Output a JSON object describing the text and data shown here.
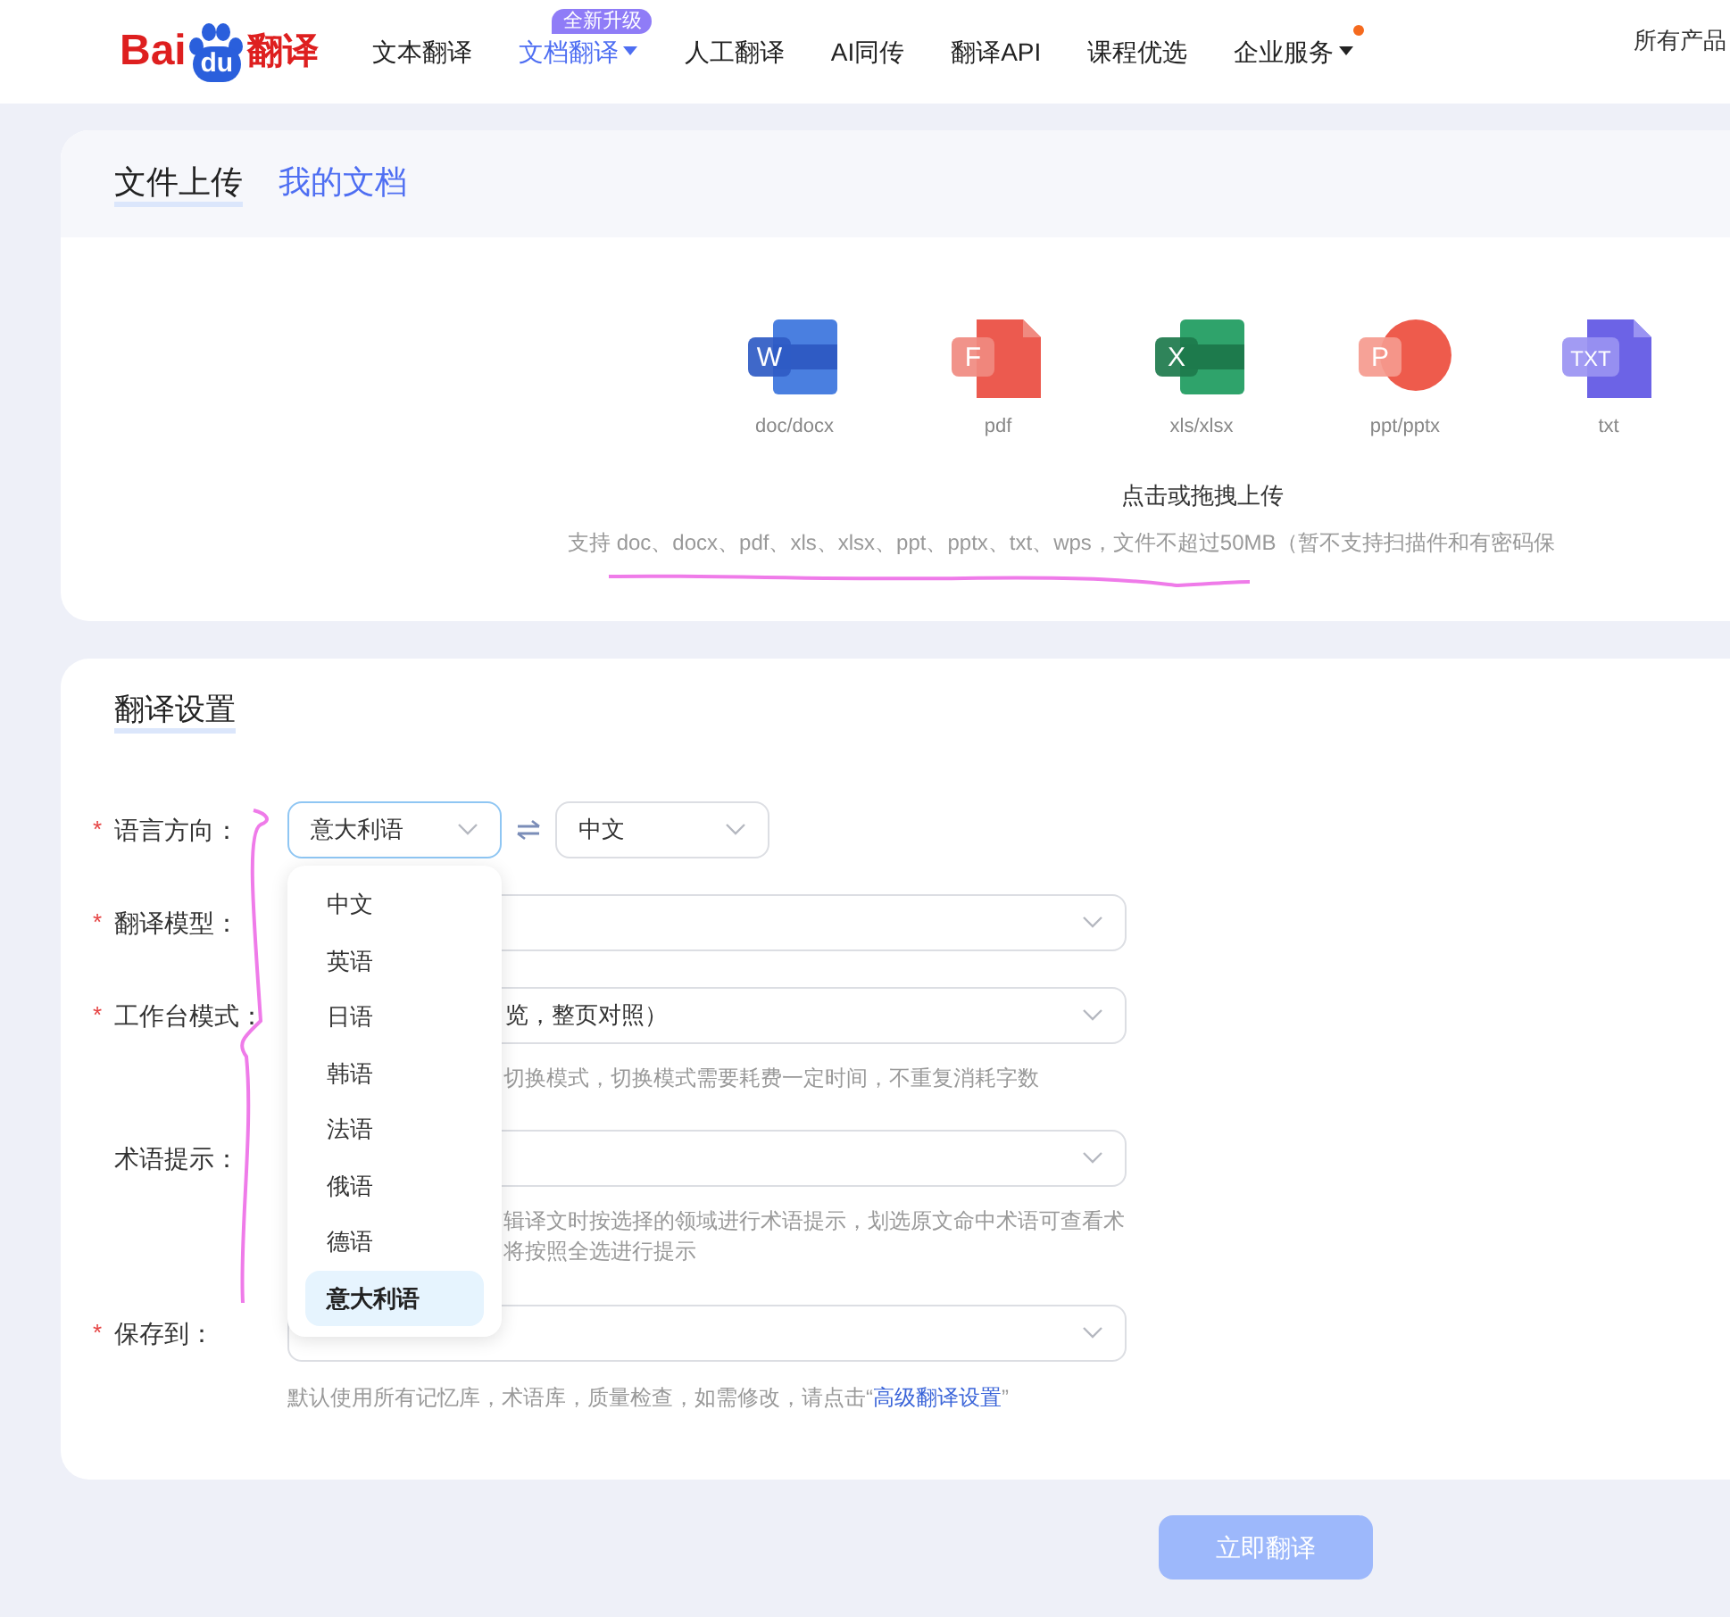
{
  "header": {
    "logo": {
      "left": "Bai",
      "paw": "du",
      "right": "翻译"
    },
    "nav": [
      {
        "label": "文本翻译",
        "selected": false,
        "caret": false,
        "dot": false
      },
      {
        "label": "文档翻译",
        "selected": true,
        "caret": true,
        "dot": false,
        "badge": "全新升级"
      },
      {
        "label": "人工翻译",
        "selected": false,
        "caret": false,
        "dot": false
      },
      {
        "label": "AI同传",
        "selected": false,
        "caret": false,
        "dot": false
      },
      {
        "label": "翻译API",
        "selected": false,
        "caret": false,
        "dot": false
      },
      {
        "label": "课程优选",
        "selected": false,
        "caret": false,
        "dot": false
      },
      {
        "label": "企业服务",
        "selected": false,
        "caret": true,
        "dot": true
      }
    ],
    "all_products": "所有产品"
  },
  "upload": {
    "tabs": [
      {
        "label": "文件上传",
        "selected": true
      },
      {
        "label": "我的文档",
        "selected": false
      }
    ],
    "file_types": [
      {
        "kind": "word",
        "letter": "W",
        "label": "doc/docx"
      },
      {
        "kind": "pdf",
        "letter": "F",
        "label": "pdf"
      },
      {
        "kind": "excel",
        "letter": "X",
        "label": "xls/xlsx"
      },
      {
        "kind": "ppt",
        "letter": "P",
        "label": "ppt/pptx"
      },
      {
        "kind": "txt",
        "letter": "TXT",
        "label": "txt"
      }
    ],
    "prompt": "点击或拖拽上传",
    "note": "支持 doc、docx、pdf、xls、xlsx、ppt、pptx、txt、wps，文件不超过50MB（暂不支持扫描件和有密码保"
  },
  "settings": {
    "title": "翻译设置",
    "rows": [
      {
        "kind": "language_pair",
        "label": "语言方向：",
        "required": "*",
        "source": "意大利语",
        "target": "中文"
      },
      {
        "kind": "select",
        "label": "翻译模型：",
        "required": "*"
      },
      {
        "kind": "select",
        "label": "工作台模式：",
        "required": "*",
        "value": "览，整页对照）",
        "hint": [
          "切换模式，切换模式需要耗费一定时间，不重复消耗字数"
        ]
      },
      {
        "kind": "select",
        "label": "术语提示：",
        "hint": [
          "辑译文时按选择的领域进行术语提示，划选原文命中术语可查看术",
          "将按照全选进行提示"
        ]
      },
      {
        "kind": "select",
        "label": "保存到：",
        "required": "*",
        "hint_rich": {
          "before": "默认使用所有记忆库，术语库，质量检查，如需修改，请点击“",
          "link": "高级翻译设置",
          "after": "”"
        }
      }
    ],
    "language_options": [
      {
        "label": "中文",
        "selected": false
      },
      {
        "label": "英语",
        "selected": false
      },
      {
        "label": "日语",
        "selected": false
      },
      {
        "label": "韩语",
        "selected": false
      },
      {
        "label": "法语",
        "selected": false
      },
      {
        "label": "俄语",
        "selected": false
      },
      {
        "label": "德语",
        "selected": false
      },
      {
        "label": "意大利语",
        "selected": true
      }
    ]
  },
  "translate_button": "立即翻译"
}
